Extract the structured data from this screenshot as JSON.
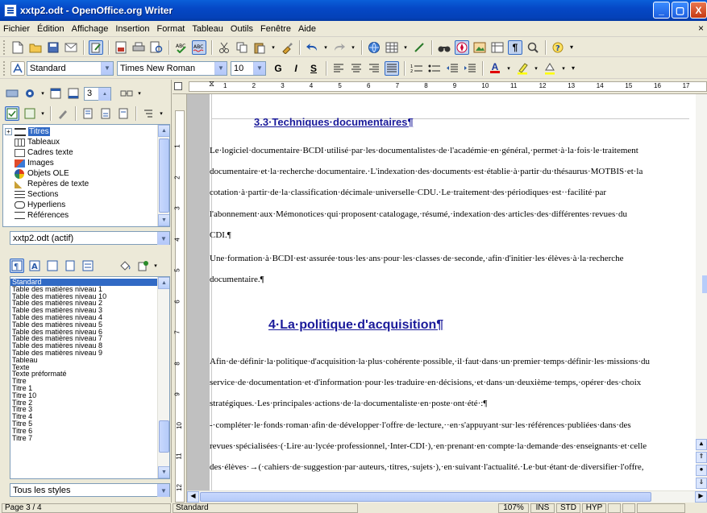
{
  "window": {
    "title": "xxtp2.odt - OpenOffice.org Writer",
    "min": "_",
    "max": "▢",
    "close": "X"
  },
  "menu": {
    "items": [
      "Fichier",
      "Édition",
      "Affichage",
      "Insertion",
      "Format",
      "Tableau",
      "Outils",
      "Fenêtre",
      "Aide"
    ],
    "close_doc": "×"
  },
  "format_bar": {
    "style_value": "Standard",
    "font_value": "Times New Roman",
    "size_value": "10",
    "bold": "G",
    "italic": "I",
    "underline": "S"
  },
  "navigator": {
    "page_spin_value": "3",
    "tree_items": [
      "Titres",
      "Tableaux",
      "Cadres texte",
      "Images",
      "Objets OLE",
      "Repères de texte",
      "Sections",
      "Hyperliens",
      "Références"
    ],
    "document_select": "xxtp2.odt (actif)"
  },
  "styles_panel": {
    "items": [
      "Standard",
      "Table des matières niveau 1",
      "Table des matières niveau 10",
      "Table des matières niveau 2",
      "Table des matières niveau 3",
      "Table des matières niveau 4",
      "Table des matières niveau 5",
      "Table des matières niveau 6",
      "Table des matières niveau 7",
      "Table des matières niveau 8",
      "Table des matières niveau 9",
      "Tableau",
      "Texte",
      "Texte préformaté",
      "Titre",
      "Titre 1",
      "Titre 10",
      "Titre 2",
      "Titre 3",
      "Titre 4",
      "Titre 5",
      "Titre 6",
      "Titre 7"
    ],
    "filter_value": "Tous les styles"
  },
  "ruler": {
    "h_ticks": [
      "1",
      "2",
      "3",
      "4",
      "5",
      "6",
      "7",
      "8",
      "9",
      "10",
      "11",
      "12",
      "13",
      "14",
      "15",
      "16",
      "17"
    ],
    "v_ticks": [
      "1",
      "2",
      "3",
      "4",
      "5",
      "6",
      "7",
      "8",
      "9",
      "10",
      "11",
      "12"
    ]
  },
  "document": {
    "heading_3_3": "3.3·Techniques·documentaires¶",
    "p1": [
      "Le·logiciel·documentaire·BCDI·utilisé·par·les·documentalistes·de·l'académie·en·général,·permet·à·la·fois·le·traitement",
      "documentaire·et·la·recherche·documentaire.·L'indexation·des·documents·est·établie·à·partir·du·thésaurus·MOTBIS·et·la",
      "cotation·à·partir·de·la·classification·décimale·universelle·CDU.·Le·traitement·des·périodiques·est··facilité·par",
      "l'abonnement·aux·Mémonotices·qui·proposent·catalogage,·résumé,·indexation·des·articles·des·différentes·revues·du",
      "CDI.¶"
    ],
    "p2": [
      "Une·formation·à·BCDI·est·assurée·tous·les·ans·pour·les·classes·de·seconde,·afin·d'initier·les·élèves·à·la·recherche",
      "documentaire.¶"
    ],
    "heading_4": "4·La·politique·d'acquisition¶",
    "p3": [
      "Afin·de·définir·la·politique·d'acquisition·la·plus·cohérente·possible,·il·faut·dans·un·premier·temps·définir·les·missions·du",
      "service·de·documentation·et·d'information·pour·les·traduire·en·décisions,·et·dans·un·deuxième·temps,·opérer·des·choix",
      "stratégiques.·Les·principales·actions·de·la·documentaliste·en·poste·ont·été·:¶",
      "-·compléter·le·fonds·roman·afin·de·développer·l'offre·de·lecture,··en·s'appuyant·sur·les·références·publiées·dans·des",
      "revues·spécialisées·(·Lire·au·lycée·professionnel,·Inter-CDI·),·en·prenant·en·compte·la·demande·des·enseignants·et·celle",
      "des·élèves·→(·cahiers·de·suggestion·par·auteurs,·titres,·sujets·),·en·suivant·l'actualité.·Le·but·étant·de·diversifier·l'offre,"
    ]
  },
  "status": {
    "page": "Page 3 / 4",
    "style": "Standard",
    "zoom": "107%",
    "ins": "INS",
    "std": "STD",
    "hyp": "HYP"
  }
}
